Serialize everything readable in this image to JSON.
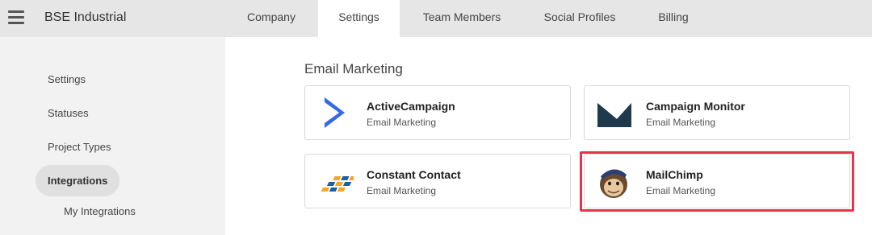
{
  "app": {
    "title": "BSE Industrial"
  },
  "tabs": [
    {
      "label": "Company"
    },
    {
      "label": "Settings"
    },
    {
      "label": "Team Members"
    },
    {
      "label": "Social Profiles"
    },
    {
      "label": "Billing"
    }
  ],
  "active_tab": "Settings",
  "sidebar": {
    "items": [
      {
        "label": "Settings"
      },
      {
        "label": "Statuses"
      },
      {
        "label": "Project Types"
      },
      {
        "label": "Integrations"
      }
    ],
    "active": "Integrations",
    "subitems": [
      {
        "label": "My Integrations"
      }
    ]
  },
  "main": {
    "section_title": "Email Marketing",
    "cards": [
      {
        "name": "ActiveCampaign",
        "category": "Email Marketing",
        "icon": "activecampaign-logo"
      },
      {
        "name": "Campaign Monitor",
        "category": "Email Marketing",
        "icon": "campaign-monitor-logo"
      },
      {
        "name": "Constant Contact",
        "category": "Email Marketing",
        "icon": "constant-contact-logo"
      },
      {
        "name": "MailChimp",
        "category": "Email Marketing",
        "icon": "mailchimp-logo"
      }
    ],
    "highlighted_card": "MailChimp"
  },
  "colors": {
    "topbar_bg": "#e6e6e6",
    "sidebar_bg": "#f2f2f2",
    "highlight_border": "#e8344a",
    "activecampaign_blue": "#356ae6",
    "campaign_monitor_navy": "#1f3a4d",
    "constant_contact_orange": "#f5a623",
    "constant_contact_blue": "#1a5ea8"
  }
}
